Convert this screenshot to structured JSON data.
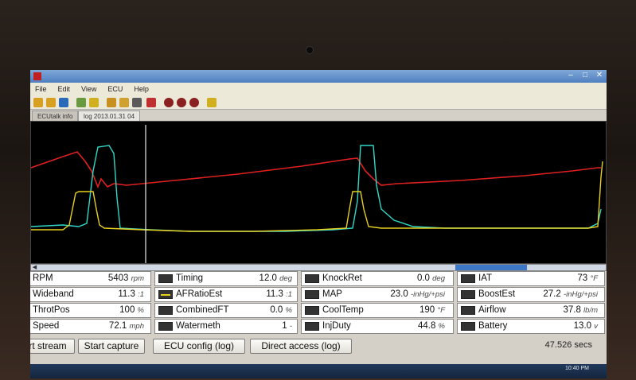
{
  "menu": [
    "File",
    "Edit",
    "View",
    "ECU",
    "Help"
  ],
  "tabs": [
    {
      "label": "ECUtalk info"
    },
    {
      "label": "log 2013.01.31 04"
    }
  ],
  "colors": {
    "rpm": "#e02020",
    "wideband": "#30d8c8",
    "afratio": "#e8d020"
  },
  "params": [
    {
      "id": "rpm",
      "label": "RPM",
      "value": "5403",
      "unit": "rpm",
      "swatch": "#e02020"
    },
    {
      "id": "timing",
      "label": "Timing",
      "value": "12.0",
      "unit": "deg",
      "swatch": ""
    },
    {
      "id": "knockret",
      "label": "KnockRet",
      "value": "0.0",
      "unit": "deg",
      "swatch": ""
    },
    {
      "id": "iat",
      "label": "IAT",
      "value": "73",
      "unit": "°F",
      "swatch": ""
    },
    {
      "id": "wideband",
      "label": "Wideband",
      "value": "11.3",
      "unit": ":1",
      "swatch": "#30d8c8"
    },
    {
      "id": "afratio",
      "label": "AFRatioEst",
      "value": "11.3",
      "unit": ":1",
      "swatch": "#e8d020"
    },
    {
      "id": "map",
      "label": "MAP",
      "value": "23.0",
      "unit": "-inHg/+psi",
      "swatch": ""
    },
    {
      "id": "boostest",
      "label": "BoostEst",
      "value": "27.2",
      "unit": "-inHg/+psi",
      "swatch": ""
    },
    {
      "id": "throtpos",
      "label": "ThrotPos",
      "value": "100",
      "unit": "%",
      "swatch": ""
    },
    {
      "id": "combinedft",
      "label": "CombinedFT",
      "value": "0.0",
      "unit": "%",
      "swatch": ""
    },
    {
      "id": "coolant",
      "label": "CoolTemp",
      "value": "190",
      "unit": "°F",
      "swatch": ""
    },
    {
      "id": "airflow",
      "label": "Airflow",
      "value": "37.8",
      "unit": "lb/m",
      "swatch": ""
    },
    {
      "id": "speed",
      "label": "Speed",
      "value": "72.1",
      "unit": "mph",
      "swatch": ""
    },
    {
      "id": "watermeth",
      "label": "Watermeth",
      "value": "1",
      "unit": "-",
      "swatch": ""
    },
    {
      "id": "injduty",
      "label": "InjDuty",
      "value": "44.8",
      "unit": "%",
      "swatch": ""
    },
    {
      "id": "battery",
      "label": "Battery",
      "value": "13.0",
      "unit": "v",
      "swatch": ""
    }
  ],
  "buttons": {
    "start_stream": "Start stream",
    "start_capture": "Start capture",
    "ecu_config": "ECU config (log)",
    "direct_access": "Direct access (log)"
  },
  "elapsed": "47.526 secs",
  "clock": "10:40 PM"
}
